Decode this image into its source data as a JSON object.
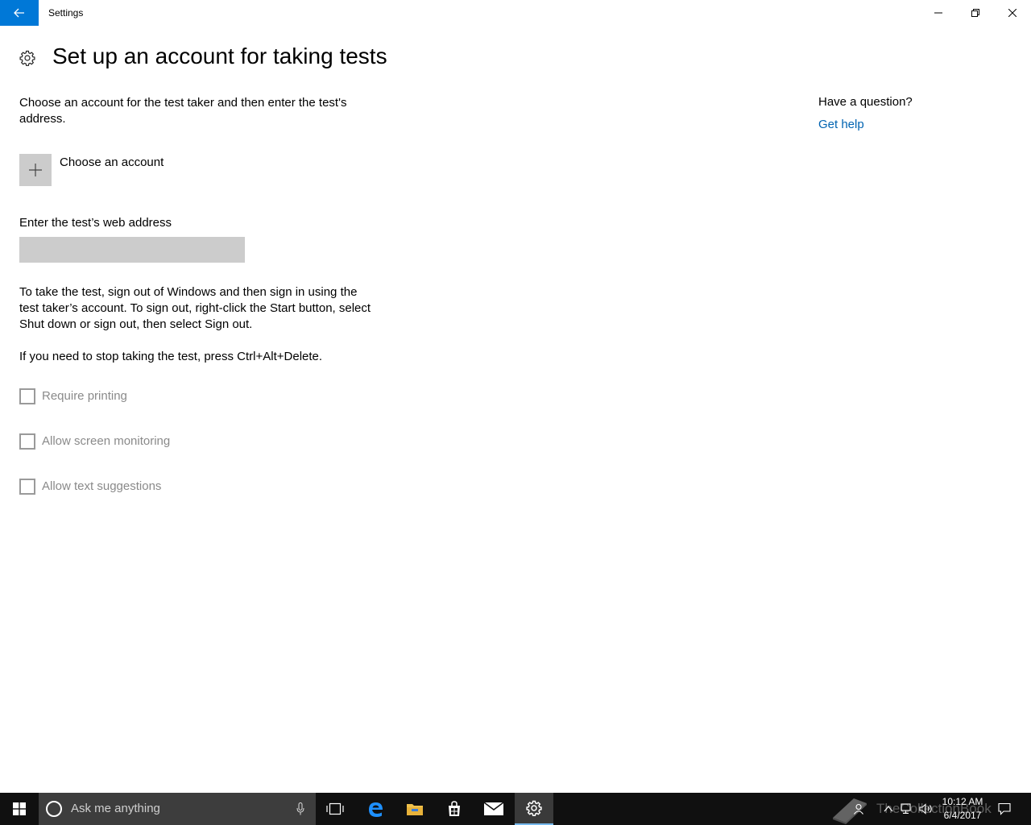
{
  "window": {
    "title": "Settings",
    "back_label": "Back",
    "minimize_label": "Minimize",
    "maximize_label": "Restore",
    "close_label": "Close"
  },
  "page": {
    "title": "Set up an account for taking tests",
    "intro": "Choose an account for the test taker and then enter the test's address.",
    "choose_account": "Choose an account",
    "url_label": "Enter the test’s web address",
    "url_value": "",
    "instructions": "To take the test, sign out of Windows and then sign in using the test taker’s account. To sign out, right-click the Start button, select Shut down or sign out, then select Sign out.",
    "stop_text": "If you need to stop taking the test, press Ctrl+Alt+Delete.",
    "checkboxes": [
      {
        "label": "Require printing",
        "checked": false,
        "enabled": false
      },
      {
        "label": "Allow screen monitoring",
        "checked": false,
        "enabled": false
      },
      {
        "label": "Allow text suggestions",
        "checked": false,
        "enabled": false
      }
    ]
  },
  "help": {
    "question": "Have a question?",
    "link": "Get help"
  },
  "taskbar": {
    "search_placeholder": "Ask me anything",
    "apps": [
      "task-view-icon",
      "edge-icon",
      "file-explorer-icon",
      "store-icon",
      "mail-icon",
      "settings-icon"
    ],
    "active_app": "settings-icon",
    "clock_time": "10:12 AM",
    "clock_date": "6/4/2017",
    "watermark": "TheCollectionBook"
  },
  "colors": {
    "accent": "#0078d7",
    "link": "#0063b1",
    "control_gray": "#cccccc",
    "disabled_text": "#8a8a8a",
    "taskbar": "#101010"
  }
}
